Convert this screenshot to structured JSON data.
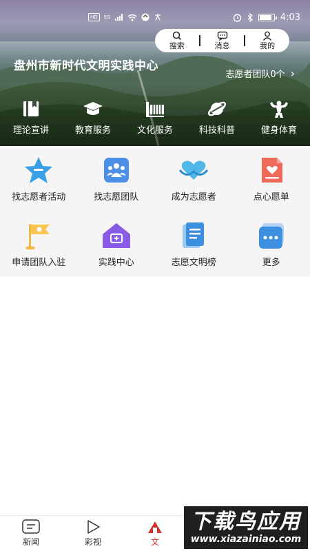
{
  "status_bar": {
    "network_badges": [
      "HD",
      "5G"
    ],
    "time": "4:03",
    "battery_level_percent": 90
  },
  "header": {
    "actions": [
      {
        "label": "搜索",
        "icon": "search-icon"
      },
      {
        "label": "消息",
        "icon": "message-icon"
      },
      {
        "label": "我的",
        "icon": "user-icon"
      }
    ],
    "title": "盘州市新时代文明实践中心",
    "team_link": "志愿者团队0个",
    "team_chevron": "›"
  },
  "categories": [
    {
      "label": "理论宣讲",
      "icon": "book-icon"
    },
    {
      "label": "教育服务",
      "icon": "graduation-cap-icon"
    },
    {
      "label": "文化服务",
      "icon": "culture-icon"
    },
    {
      "label": "科技科普",
      "icon": "planet-icon"
    },
    {
      "label": "健身体育",
      "icon": "bodybuilder-icon"
    }
  ],
  "services": [
    {
      "label": "找志愿者活动",
      "icon": "star-badge-icon"
    },
    {
      "label": "找志愿团队",
      "icon": "team-icon"
    },
    {
      "label": "成为志愿者",
      "icon": "heart-hands-icon"
    },
    {
      "label": "点心愿单",
      "icon": "wish-list-icon"
    },
    {
      "label": "申请团队入驻",
      "icon": "flag-icon"
    },
    {
      "label": "实践中心",
      "icon": "house-icon"
    },
    {
      "label": "志愿文明榜",
      "icon": "document-icon"
    },
    {
      "label": "更多",
      "icon": "more-icon"
    }
  ],
  "bottom_nav": [
    {
      "label": "新闻",
      "icon": "news-icon"
    },
    {
      "label": "彩视",
      "icon": "play-icon"
    },
    {
      "label": "文",
      "icon": "civilization-icon",
      "active": true
    }
  ],
  "watermark": {
    "title": "下载鸟应用",
    "url": "www.xiazainiao.com"
  },
  "colors": {
    "accent": "#d0342c",
    "grid_bg": "#f5f5f5"
  }
}
